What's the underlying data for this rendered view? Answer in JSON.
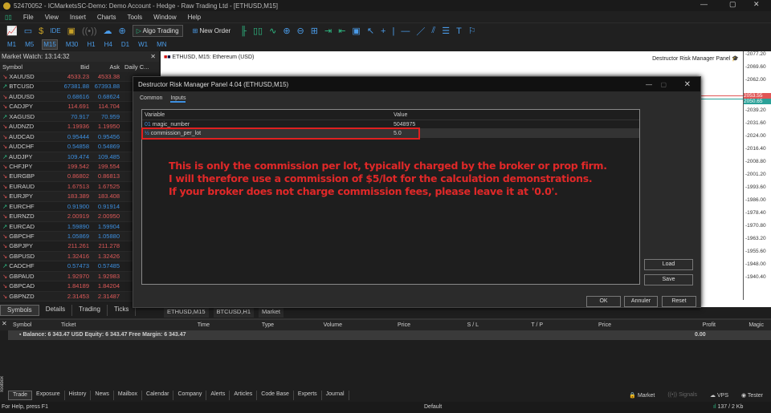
{
  "window": {
    "title": "52470052 - ICMarketsSC-Demo: Demo Account - Hedge - Raw Trading Ltd - [ETHUSD,M15]"
  },
  "menu": [
    "File",
    "View",
    "Insert",
    "Charts",
    "Tools",
    "Window",
    "Help"
  ],
  "toolbar": {
    "ide": "IDE",
    "algo": "Algo Trading",
    "new_order": "New Order"
  },
  "timeframes": [
    "M1",
    "M5",
    "M15",
    "M30",
    "H1",
    "H4",
    "D1",
    "W1",
    "MN"
  ],
  "market_watch": {
    "title": "Market Watch: 13:14:32",
    "columns": [
      "Symbol",
      "Bid",
      "Ask",
      "Daily C..."
    ],
    "rows": [
      [
        "XAUUSD",
        "4533.23",
        "4533.38",
        "dn",
        "red"
      ],
      [
        "BTCUSD",
        "67381.88",
        "67393.88",
        "up",
        "blue"
      ],
      [
        "AUDUSD",
        "0.68616",
        "0.68624",
        "dn",
        "blue"
      ],
      [
        "CADJPY",
        "114.691",
        "114.704",
        "dn",
        "red"
      ],
      [
        "XAGUSD",
        "70.917",
        "70.959",
        "up",
        "blue"
      ],
      [
        "AUDNZD",
        "1.19936",
        "1.19950",
        "dn",
        "red"
      ],
      [
        "AUDCAD",
        "0.95444",
        "0.95456",
        "dn",
        "blue"
      ],
      [
        "AUDCHF",
        "0.54858",
        "0.54869",
        "dn",
        "blue"
      ],
      [
        "AUDJPY",
        "109.474",
        "109.485",
        "up",
        "blue"
      ],
      [
        "CHFJPY",
        "199.542",
        "199.554",
        "dn",
        "red"
      ],
      [
        "EURGBP",
        "0.86802",
        "0.86813",
        "dn",
        "red"
      ],
      [
        "EURAUD",
        "1.67513",
        "1.67525",
        "dn",
        "red"
      ],
      [
        "EURJPY",
        "183.389",
        "183.408",
        "dn",
        "red"
      ],
      [
        "EURCHF",
        "0.91900",
        "0.91914",
        "up",
        "blue"
      ],
      [
        "EURNZD",
        "2.00919",
        "2.00950",
        "dn",
        "red"
      ],
      [
        "EURCAD",
        "1.59890",
        "1.59904",
        "up",
        "blue"
      ],
      [
        "GBPCHF",
        "1.05869",
        "1.05880",
        "dn",
        "blue"
      ],
      [
        "GBPJPY",
        "211.261",
        "211.278",
        "dn",
        "red"
      ],
      [
        "GBPUSD",
        "1.32416",
        "1.32426",
        "dn",
        "red"
      ],
      [
        "CADCHF",
        "0.57473",
        "0.57485",
        "up",
        "blue"
      ],
      [
        "GBPAUD",
        "1.92970",
        "1.92983",
        "dn",
        "red"
      ],
      [
        "GBPCAD",
        "1.84189",
        "1.84204",
        "dn",
        "red"
      ],
      [
        "GBPNZD",
        "2.31453",
        "2.31487",
        "dn",
        "red"
      ]
    ],
    "tabs": [
      "Symbols",
      "Details",
      "Trading",
      "Ticks"
    ]
  },
  "chart": {
    "header": "ETHUSD, M15:  Ethereum (USD)",
    "ea_label": "Destructor Risk Manager Panel",
    "price_ticks": [
      "2077.20",
      "2069.60",
      "2062.00",
      "2046.80",
      "2039.20",
      "2031.60",
      "2024.00",
      "2016.40",
      "2008.80",
      "2001.20",
      "1993.60",
      "1986.00",
      "1978.40",
      "1970.80",
      "1963.20",
      "1955.60",
      "1948.00",
      "1940.40"
    ],
    "bid_tag": "2053.55",
    "ask_tag": "2050.65",
    "tabs": [
      "ETHUSD,M15",
      "BTCUSD,H1",
      "Market"
    ]
  },
  "dialog": {
    "title": "Destructor Risk Manager Panel 4.04 (ETHUSD,M15)",
    "tabs": [
      "Common",
      "Inputs"
    ],
    "columns": [
      "Variable",
      "Value"
    ],
    "rows": [
      {
        "icon": "01",
        "name": "magic_number",
        "value": "5048975"
      },
      {
        "icon": "½",
        "name": "commission_per_lot",
        "value": "5.0"
      }
    ],
    "note": [
      "This is only the commission per lot, typically charged by the broker or prop firm.",
      "I will therefore use a commission of $5/lot for the calculation demonstrations.",
      "If your broker does not charge commission fees, please leave it at '0.0'."
    ],
    "buttons": {
      "load": "Load",
      "save": "Save",
      "ok": "OK",
      "cancel": "Annuler",
      "reset": "Reset"
    },
    "highlight_color": "#e02020"
  },
  "toolbox": {
    "label": "Toolbox",
    "columns": [
      "Symbol",
      "Ticket",
      "Time",
      "Type",
      "Volume",
      "Price",
      "S / L",
      "T / P",
      "Price",
      "Profit",
      "Magic"
    ],
    "balance": "Balance: 6 343.47 USD  Equity: 6 343.47  Free Margin: 6 343.47",
    "profit": "0.00",
    "tabs": [
      "Trade",
      "Exposure",
      "History",
      "News",
      "Mailbox",
      "Calendar",
      "Company",
      "Alerts",
      "Articles",
      "Code Base",
      "Experts",
      "Journal"
    ],
    "right": [
      "Market",
      "Signals",
      "VPS",
      "Tester"
    ]
  },
  "status": {
    "help": "For Help, press F1",
    "profile": "Default",
    "conn": "137 / 2 Kb"
  }
}
